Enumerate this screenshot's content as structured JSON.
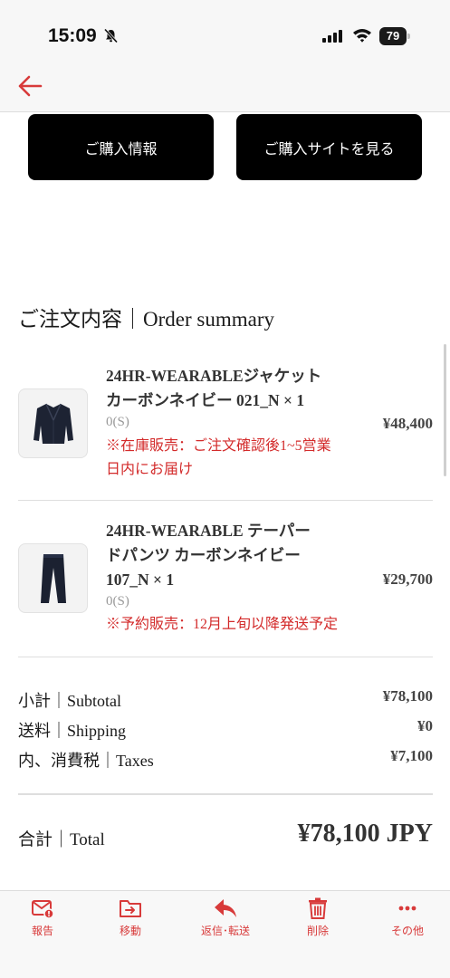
{
  "status_bar": {
    "time": "15:09",
    "battery": "79"
  },
  "actions": {
    "purchase_info": "ご購入情報",
    "view_site": "ご購入サイトを見る"
  },
  "order": {
    "title": "ご注文内容｜Order summary",
    "items": [
      {
        "name_line1": "24HR-WEARABLEジャケット",
        "name_line2": "カーボンネイビー 021_N × 1",
        "variant": "0(S)",
        "note_line1": "※在庫販売：ご注文確認後1~5営業",
        "note_line2": "日内にお届け",
        "price": "¥48,400"
      },
      {
        "name_line1": "24HR-WEARABLE テーパー",
        "name_line2": "ドパンツ カーボンネイビー",
        "name_line3": "107_N × 1",
        "variant": "0(S)",
        "note_line1": "※予約販売：12月上旬以降発送予定",
        "price": "¥29,700"
      }
    ],
    "summary": {
      "subtotal_label": "小計｜Subtotal",
      "subtotal_value": "¥78,100",
      "shipping_label": "送料｜Shipping",
      "shipping_value": "¥0",
      "taxes_label": "内、消費税｜Taxes",
      "taxes_value": "¥7,100",
      "total_label": "合計｜Total",
      "total_value": "¥78,100 JPY"
    }
  },
  "toolbar": {
    "report": "報告",
    "move": "移動",
    "reply_forward": "返信･転送",
    "delete": "削除",
    "more": "その他"
  },
  "colors": {
    "accent": "#d83a3a",
    "button_bg": "#000000",
    "note_red": "#d32b2b"
  }
}
